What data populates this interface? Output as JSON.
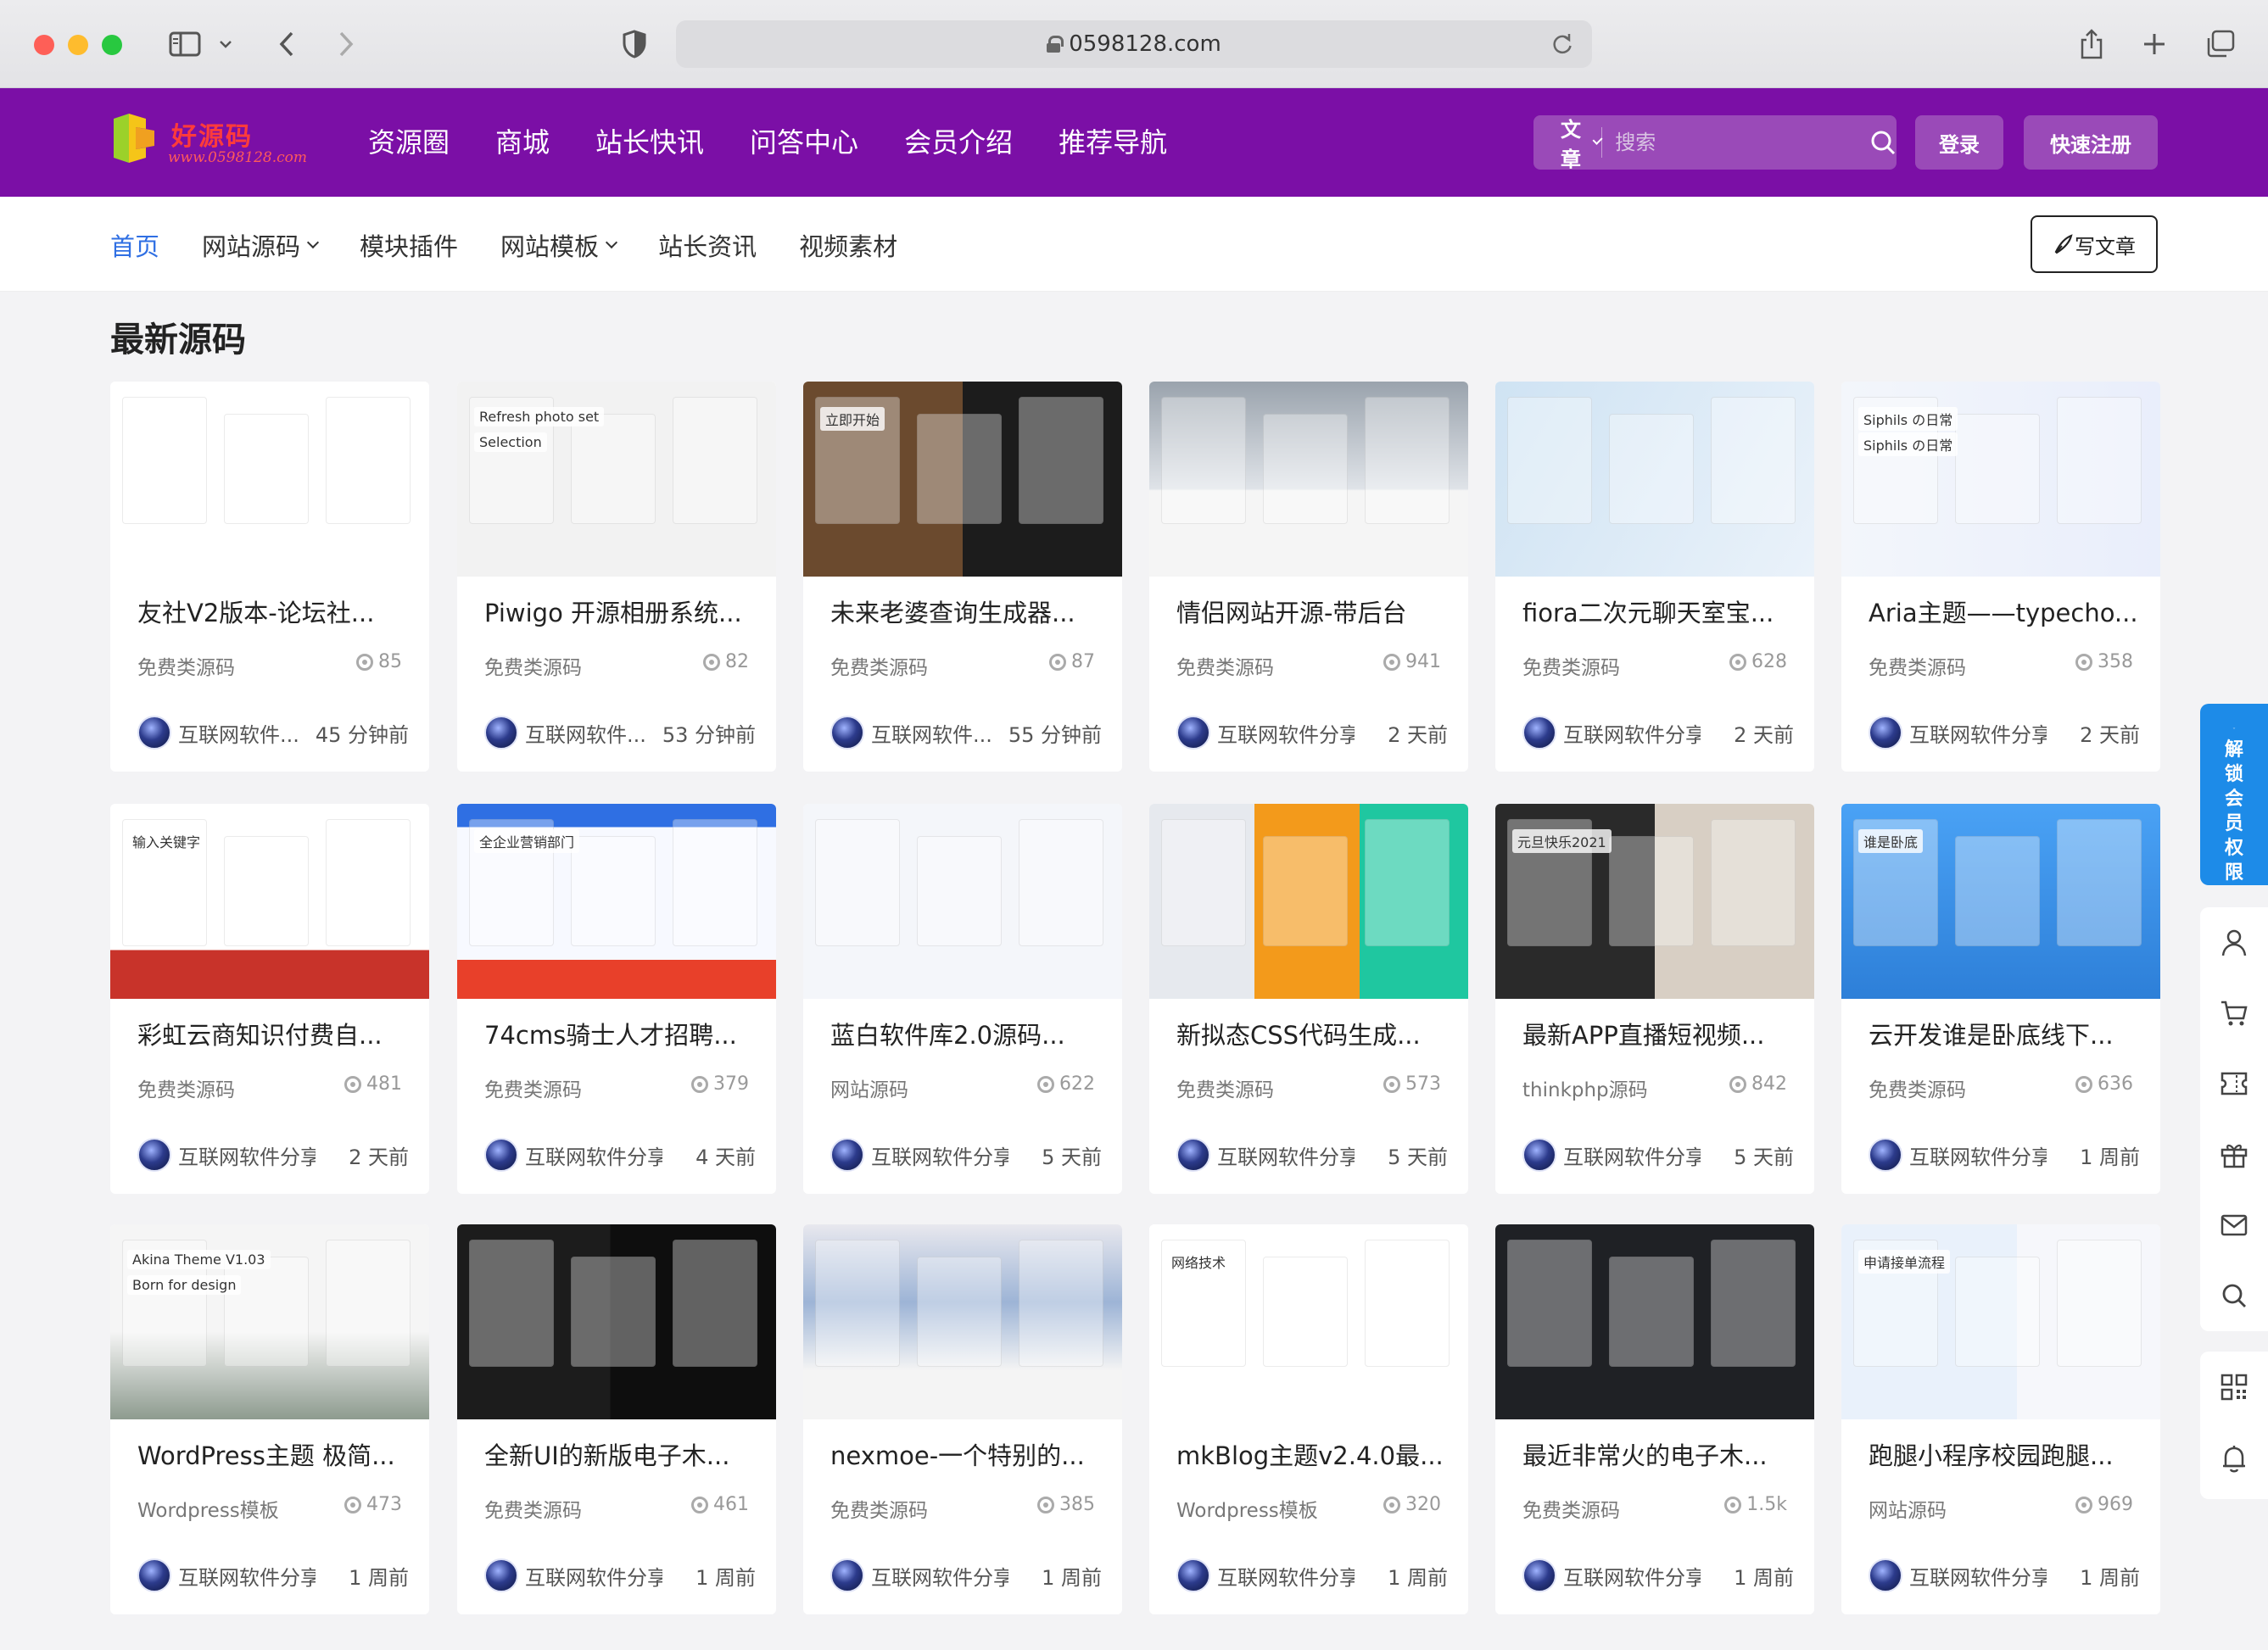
{
  "browser": {
    "url": "0598128.com"
  },
  "header": {
    "logo_text": "好源码",
    "logo_sub": "www.0598128.com",
    "nav": [
      "资源圈",
      "商城",
      "站长快讯",
      "问答中心",
      "会员介绍",
      "推荐导航"
    ],
    "search_type": "文章",
    "search_placeholder": "搜索",
    "login": "登录",
    "register": "快速注册",
    "brand_color": "#7b0fa6"
  },
  "subnav": {
    "items": [
      "首页",
      "网站源码",
      "模块插件",
      "网站模板",
      "站长资讯",
      "视频素材"
    ],
    "write": "写文章"
  },
  "section_title": "最新源码",
  "cards": [
    {
      "title": "友社V2版本-论坛社...",
      "category": "免费类源码",
      "views": "85",
      "author": "互联网软件...",
      "time": "45 分钟前"
    },
    {
      "title": "Piwigo 开源相册系统...",
      "category": "免费类源码",
      "views": "82",
      "author": "互联网软件...",
      "time": "53 分钟前"
    },
    {
      "title": "未来老婆查询生成器...",
      "category": "免费类源码",
      "views": "87",
      "author": "互联网软件...",
      "time": "55 分钟前"
    },
    {
      "title": "情侣网站开源-带后台",
      "category": "免费类源码",
      "views": "941",
      "author": "互联网软件分享",
      "time": "2 天前"
    },
    {
      "title": "fiora二次元聊天室宝...",
      "category": "免费类源码",
      "views": "628",
      "author": "互联网软件分享",
      "time": "2 天前"
    },
    {
      "title": "Aria主题——typecho...",
      "category": "免费类源码",
      "views": "358",
      "author": "互联网软件分享",
      "time": "2 天前"
    },
    {
      "title": "彩虹云商知识付费自...",
      "category": "免费类源码",
      "views": "481",
      "author": "互联网软件分享",
      "time": "2 天前"
    },
    {
      "title": "74cms骑士人才招聘...",
      "category": "免费类源码",
      "views": "379",
      "author": "互联网软件分享",
      "time": "4 天前"
    },
    {
      "title": "蓝白软件库2.0源码...",
      "category": "网站源码",
      "views": "622",
      "author": "互联网软件分享",
      "time": "5 天前"
    },
    {
      "title": "新拟态CSS代码生成...",
      "category": "免费类源码",
      "views": "573",
      "author": "互联网软件分享",
      "time": "5 天前"
    },
    {
      "title": "最新APP直播短视频...",
      "category": "thinkphp源码",
      "views": "842",
      "author": "互联网软件分享",
      "time": "5 天前"
    },
    {
      "title": "云开发谁是卧底线下...",
      "category": "免费类源码",
      "views": "636",
      "author": "互联网软件分享",
      "time": "1 周前"
    },
    {
      "title": "WordPress主题 极简...",
      "category": "Wordpress模板",
      "views": "473",
      "author": "互联网软件分享",
      "time": "1 周前"
    },
    {
      "title": "全新UI的新版电子木...",
      "category": "免费类源码",
      "views": "461",
      "author": "互联网软件分享",
      "time": "1 周前"
    },
    {
      "title": "nexmoe-一个特别的...",
      "category": "免费类源码",
      "views": "385",
      "author": "互联网软件分享",
      "time": "1 周前"
    },
    {
      "title": "mkBlog主题v2.4.0最...",
      "category": "Wordpress模板",
      "views": "320",
      "author": "互联网软件分享",
      "time": "1 周前"
    },
    {
      "title": "最近非常火的电子木...",
      "category": "免费类源码",
      "views": "1.5k",
      "author": "互联网软件分享",
      "time": "1 周前"
    },
    {
      "title": "跑腿小程序校园跑腿...",
      "category": "网站源码",
      "views": "969",
      "author": "互联网软件分享",
      "time": "1 周前"
    }
  ],
  "thumbnails": [
    {
      "texts": []
    },
    {
      "texts": [
        "Refresh photo set",
        "Selection"
      ]
    },
    {
      "texts": [
        "立即开始"
      ]
    },
    {
      "texts": []
    },
    {
      "texts": []
    },
    {
      "texts": [
        "Siphils の日常",
        "Siphils の日常"
      ]
    },
    {
      "texts": [
        "输入关键字"
      ]
    },
    {
      "texts": [
        "全企业营销部门"
      ]
    },
    {
      "texts": []
    },
    {
      "texts": []
    },
    {
      "texts": [
        "元旦快乐2021"
      ]
    },
    {
      "texts": [
        "谁是卧底"
      ]
    },
    {
      "texts": [
        "Akina Theme V1.03",
        "Born for design"
      ]
    },
    {
      "texts": []
    },
    {
      "texts": []
    },
    {
      "texts": [
        "网络技术"
      ]
    },
    {
      "texts": []
    },
    {
      "texts": [
        "申请接单流程"
      ]
    }
  ],
  "unlock": "解锁会员权限",
  "sidebar_icons": [
    "user-icon",
    "cart-icon",
    "coupon-icon",
    "gift-icon",
    "message-icon",
    "search-icon",
    "qrcode-icon",
    "bell-icon"
  ]
}
